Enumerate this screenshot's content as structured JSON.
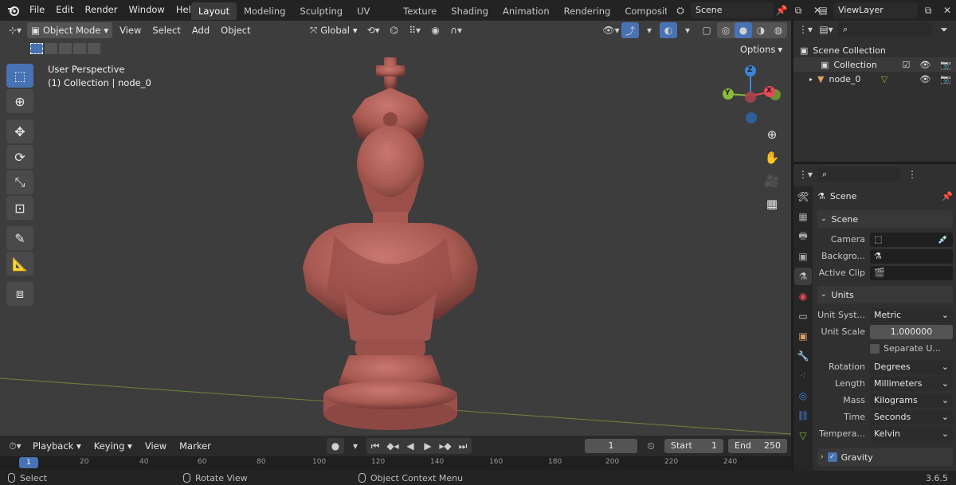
{
  "menubar": {
    "items": [
      "File",
      "Edit",
      "Render",
      "Window",
      "Help"
    ],
    "workspaces": [
      "Layout",
      "Modeling",
      "Sculpting",
      "UV Editing",
      "Texture Paint",
      "Shading",
      "Animation",
      "Rendering",
      "Compositi"
    ],
    "active_workspace": "Layout",
    "scene_name": "Scene",
    "view_layer": "ViewLayer"
  },
  "viewport": {
    "mode": "Object Mode",
    "menu": [
      "View",
      "Select",
      "Add",
      "Object"
    ],
    "transform_orientation": "Global",
    "options_label": "Options",
    "overlay_title": "User Perspective",
    "overlay_subtitle": "(1) Collection | node_0",
    "gizmo": {
      "z": "Z",
      "y": "Y",
      "x": "X"
    },
    "object_color": "#a85a52",
    "background_color": "#3d3d3d"
  },
  "outliner": {
    "root": "Scene Collection",
    "collection": "Collection",
    "object": "node_0"
  },
  "properties": {
    "title": "Scene",
    "scene_panel": "Scene",
    "camera_label": "Camera",
    "background_label": "Backgro...",
    "active_clip_label": "Active Clip",
    "units_panel": "Units",
    "unit_system_label": "Unit Syst...",
    "unit_system": "Metric",
    "unit_scale_label": "Unit Scale",
    "unit_scale": "1.000000",
    "separate_units": "Separate U...",
    "rotation_label": "Rotation",
    "rotation": "Degrees",
    "length_label": "Length",
    "length": "Millimeters",
    "mass_label": "Mass",
    "mass": "Kilograms",
    "time_label": "Time",
    "time": "Seconds",
    "temperature_label": "Tempera...",
    "temperature": "Kelvin",
    "gravity_panel": "Gravity"
  },
  "timeline": {
    "menu": [
      "Playback",
      "Keying",
      "View",
      "Marker"
    ],
    "current_frame": "1",
    "start_label": "Start",
    "start": "1",
    "end_label": "End",
    "end": "250",
    "ruler": [
      "1",
      "20",
      "40",
      "60",
      "80",
      "100",
      "120",
      "140",
      "160",
      "180",
      "200",
      "220",
      "240"
    ]
  },
  "statusbar": {
    "select": "Select",
    "rotate": "Rotate View",
    "context": "Object Context Menu",
    "version": "3.6.5"
  },
  "colors": {
    "accent": "#4772b3",
    "axis_x": "#e8475a",
    "axis_y": "#8bbb3c",
    "axis_z": "#3f83d6"
  }
}
